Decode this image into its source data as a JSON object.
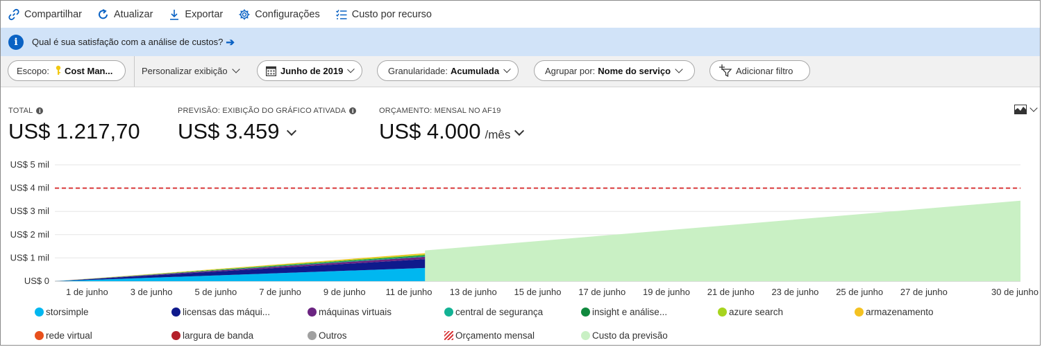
{
  "toolbar": {
    "share": "Compartilhar",
    "refresh": "Atualizar",
    "export": "Exportar",
    "settings": "Configurações",
    "cost_by_resource": "Custo por recurso"
  },
  "banner": {
    "text": "Qual é sua satisfação com a análise de custos?"
  },
  "filters": {
    "scope_label": "Escopo:",
    "scope_value": "Cost Man...",
    "customize": "Personalizar exibição",
    "date": "Junho de 2019",
    "granularity_label": "Granularidade:",
    "granularity_value": "Acumulada",
    "group_label": "Agrupar por:",
    "group_value": "Nome do serviço",
    "add_filter": "Adicionar filtro"
  },
  "kpis": {
    "total_label": "TOTAL",
    "total_value": "US$ 1.217,70",
    "forecast_label": "PREVISÃO: EXIBIÇÃO DO GRÁFICO ATIVADA",
    "forecast_value": "US$ 3.459",
    "budget_label": "ORÇAMENTO: MENSAL NO AF19",
    "budget_value": "US$ 4.000",
    "budget_suffix": "/mês"
  },
  "colors": {
    "accent": "#0a62c4",
    "banner_bg": "#d1e3f8",
    "forecast_fill": "#c9f0c4",
    "budget_line": "#d9383a"
  },
  "chart_data": {
    "type": "area",
    "y_tick_labels": [
      "US$ 0",
      "US$ 1 mil",
      "US$ 2 mil",
      "US$ 3 mil",
      "US$ 4 mil",
      "US$ 5 mil"
    ],
    "y_ticks": [
      0,
      1000,
      2000,
      3000,
      4000,
      5000
    ],
    "ylim": [
      0,
      5000
    ],
    "x_tick_labels": [
      "1 de junho",
      "3 de junho",
      "5 de junho",
      "7 de junho",
      "9 de junho",
      "11 de junho",
      "13 de junho",
      "15 de junho",
      "17 de junho",
      "19 de junho",
      "21 de junho",
      "23 de junho",
      "25 de junho",
      "27 de junho",
      "30 de junho"
    ],
    "x_ticks": [
      1,
      3,
      5,
      7,
      9,
      11,
      13,
      15,
      17,
      19,
      21,
      23,
      25,
      27,
      30
    ],
    "xlim": [
      0,
      30
    ],
    "budget": 4000,
    "actual_x": [
      0,
      11.5
    ],
    "series": [
      {
        "name": "storsimple",
        "color": "#00b7f0",
        "values": [
          0,
          570
        ]
      },
      {
        "name": "licensas das máqui...",
        "color": "#0f1a8c",
        "values": [
          0,
          380
        ]
      },
      {
        "name": "máquinas virtuais",
        "color": "#6b2481",
        "values": [
          0,
          100
        ]
      },
      {
        "name": "central de segurança",
        "color": "#13b294",
        "values": [
          0,
          30
        ]
      },
      {
        "name": "insight e análise...",
        "color": "#10893e",
        "values": [
          0,
          40
        ]
      },
      {
        "name": "azure search",
        "color": "#a7d41e",
        "values": [
          0,
          40
        ]
      },
      {
        "name": "armazenamento",
        "color": "#f4c221",
        "values": [
          0,
          40
        ]
      },
      {
        "name": "rede virtual",
        "color": "#e8501c",
        "values": [
          0,
          0
        ]
      },
      {
        "name": "largura de banda",
        "color": "#b4202a",
        "values": [
          0,
          0
        ]
      },
      {
        "name": "Outros",
        "color": "#a0a0a0",
        "values": [
          0,
          0
        ]
      }
    ],
    "forecast": {
      "name": "Custo da previsão",
      "color": "#c9f0c4",
      "x": [
        11.5,
        30
      ],
      "values": [
        1320,
        3459
      ]
    },
    "budget_legend": "Orçamento mensal"
  }
}
